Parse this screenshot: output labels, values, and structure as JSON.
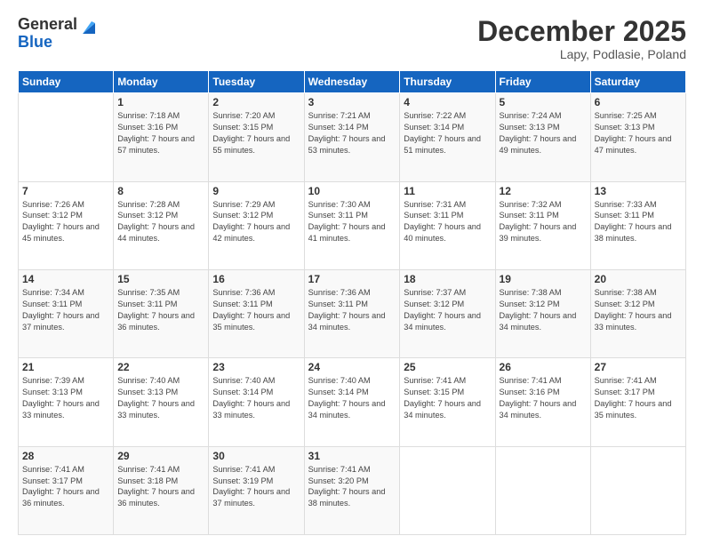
{
  "header": {
    "logo_general": "General",
    "logo_blue": "Blue",
    "month_title": "December 2025",
    "location": "Lapy, Podlasie, Poland"
  },
  "weekdays": [
    "Sunday",
    "Monday",
    "Tuesday",
    "Wednesday",
    "Thursday",
    "Friday",
    "Saturday"
  ],
  "weeks": [
    [
      {
        "day": "",
        "sunrise": "",
        "sunset": "",
        "daylight": ""
      },
      {
        "day": "1",
        "sunrise": "Sunrise: 7:18 AM",
        "sunset": "Sunset: 3:16 PM",
        "daylight": "Daylight: 7 hours and 57 minutes."
      },
      {
        "day": "2",
        "sunrise": "Sunrise: 7:20 AM",
        "sunset": "Sunset: 3:15 PM",
        "daylight": "Daylight: 7 hours and 55 minutes."
      },
      {
        "day": "3",
        "sunrise": "Sunrise: 7:21 AM",
        "sunset": "Sunset: 3:14 PM",
        "daylight": "Daylight: 7 hours and 53 minutes."
      },
      {
        "day": "4",
        "sunrise": "Sunrise: 7:22 AM",
        "sunset": "Sunset: 3:14 PM",
        "daylight": "Daylight: 7 hours and 51 minutes."
      },
      {
        "day": "5",
        "sunrise": "Sunrise: 7:24 AM",
        "sunset": "Sunset: 3:13 PM",
        "daylight": "Daylight: 7 hours and 49 minutes."
      },
      {
        "day": "6",
        "sunrise": "Sunrise: 7:25 AM",
        "sunset": "Sunset: 3:13 PM",
        "daylight": "Daylight: 7 hours and 47 minutes."
      }
    ],
    [
      {
        "day": "7",
        "sunrise": "Sunrise: 7:26 AM",
        "sunset": "Sunset: 3:12 PM",
        "daylight": "Daylight: 7 hours and 45 minutes."
      },
      {
        "day": "8",
        "sunrise": "Sunrise: 7:28 AM",
        "sunset": "Sunset: 3:12 PM",
        "daylight": "Daylight: 7 hours and 44 minutes."
      },
      {
        "day": "9",
        "sunrise": "Sunrise: 7:29 AM",
        "sunset": "Sunset: 3:12 PM",
        "daylight": "Daylight: 7 hours and 42 minutes."
      },
      {
        "day": "10",
        "sunrise": "Sunrise: 7:30 AM",
        "sunset": "Sunset: 3:11 PM",
        "daylight": "Daylight: 7 hours and 41 minutes."
      },
      {
        "day": "11",
        "sunrise": "Sunrise: 7:31 AM",
        "sunset": "Sunset: 3:11 PM",
        "daylight": "Daylight: 7 hours and 40 minutes."
      },
      {
        "day": "12",
        "sunrise": "Sunrise: 7:32 AM",
        "sunset": "Sunset: 3:11 PM",
        "daylight": "Daylight: 7 hours and 39 minutes."
      },
      {
        "day": "13",
        "sunrise": "Sunrise: 7:33 AM",
        "sunset": "Sunset: 3:11 PM",
        "daylight": "Daylight: 7 hours and 38 minutes."
      }
    ],
    [
      {
        "day": "14",
        "sunrise": "Sunrise: 7:34 AM",
        "sunset": "Sunset: 3:11 PM",
        "daylight": "Daylight: 7 hours and 37 minutes."
      },
      {
        "day": "15",
        "sunrise": "Sunrise: 7:35 AM",
        "sunset": "Sunset: 3:11 PM",
        "daylight": "Daylight: 7 hours and 36 minutes."
      },
      {
        "day": "16",
        "sunrise": "Sunrise: 7:36 AM",
        "sunset": "Sunset: 3:11 PM",
        "daylight": "Daylight: 7 hours and 35 minutes."
      },
      {
        "day": "17",
        "sunrise": "Sunrise: 7:36 AM",
        "sunset": "Sunset: 3:11 PM",
        "daylight": "Daylight: 7 hours and 34 minutes."
      },
      {
        "day": "18",
        "sunrise": "Sunrise: 7:37 AM",
        "sunset": "Sunset: 3:12 PM",
        "daylight": "Daylight: 7 hours and 34 minutes."
      },
      {
        "day": "19",
        "sunrise": "Sunrise: 7:38 AM",
        "sunset": "Sunset: 3:12 PM",
        "daylight": "Daylight: 7 hours and 34 minutes."
      },
      {
        "day": "20",
        "sunrise": "Sunrise: 7:38 AM",
        "sunset": "Sunset: 3:12 PM",
        "daylight": "Daylight: 7 hours and 33 minutes."
      }
    ],
    [
      {
        "day": "21",
        "sunrise": "Sunrise: 7:39 AM",
        "sunset": "Sunset: 3:13 PM",
        "daylight": "Daylight: 7 hours and 33 minutes."
      },
      {
        "day": "22",
        "sunrise": "Sunrise: 7:40 AM",
        "sunset": "Sunset: 3:13 PM",
        "daylight": "Daylight: 7 hours and 33 minutes."
      },
      {
        "day": "23",
        "sunrise": "Sunrise: 7:40 AM",
        "sunset": "Sunset: 3:14 PM",
        "daylight": "Daylight: 7 hours and 33 minutes."
      },
      {
        "day": "24",
        "sunrise": "Sunrise: 7:40 AM",
        "sunset": "Sunset: 3:14 PM",
        "daylight": "Daylight: 7 hours and 34 minutes."
      },
      {
        "day": "25",
        "sunrise": "Sunrise: 7:41 AM",
        "sunset": "Sunset: 3:15 PM",
        "daylight": "Daylight: 7 hours and 34 minutes."
      },
      {
        "day": "26",
        "sunrise": "Sunrise: 7:41 AM",
        "sunset": "Sunset: 3:16 PM",
        "daylight": "Daylight: 7 hours and 34 minutes."
      },
      {
        "day": "27",
        "sunrise": "Sunrise: 7:41 AM",
        "sunset": "Sunset: 3:17 PM",
        "daylight": "Daylight: 7 hours and 35 minutes."
      }
    ],
    [
      {
        "day": "28",
        "sunrise": "Sunrise: 7:41 AM",
        "sunset": "Sunset: 3:17 PM",
        "daylight": "Daylight: 7 hours and 36 minutes."
      },
      {
        "day": "29",
        "sunrise": "Sunrise: 7:41 AM",
        "sunset": "Sunset: 3:18 PM",
        "daylight": "Daylight: 7 hours and 36 minutes."
      },
      {
        "day": "30",
        "sunrise": "Sunrise: 7:41 AM",
        "sunset": "Sunset: 3:19 PM",
        "daylight": "Daylight: 7 hours and 37 minutes."
      },
      {
        "day": "31",
        "sunrise": "Sunrise: 7:41 AM",
        "sunset": "Sunset: 3:20 PM",
        "daylight": "Daylight: 7 hours and 38 minutes."
      },
      {
        "day": "",
        "sunrise": "",
        "sunset": "",
        "daylight": ""
      },
      {
        "day": "",
        "sunrise": "",
        "sunset": "",
        "daylight": ""
      },
      {
        "day": "",
        "sunrise": "",
        "sunset": "",
        "daylight": ""
      }
    ]
  ]
}
